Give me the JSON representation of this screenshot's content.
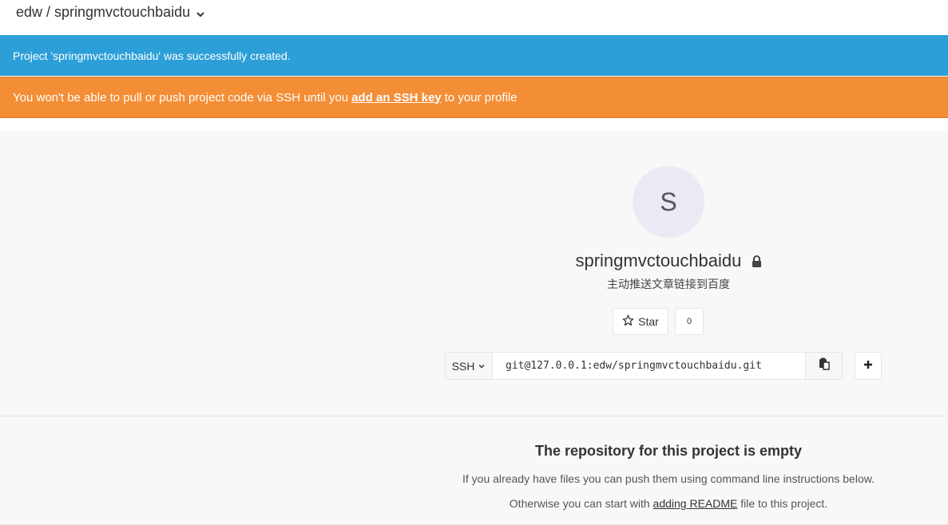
{
  "header": {
    "breadcrumb": "edw / springmvctouchbaidu"
  },
  "flash": {
    "notice": "Project 'springmvctouchbaidu' was successfully created.",
    "warning_prefix": "You won't be able to pull or push project code via SSH until you",
    "warning_link": "add an SSH key",
    "warning_suffix": "to your profile"
  },
  "project": {
    "avatar_letter": "S",
    "name": "springmvctouchbaidu",
    "description": "主动推送文章链接到百度",
    "star_label": "Star",
    "star_count": "0",
    "protocol": "SSH",
    "clone_url": "git@127.0.0.1:edw/springmvctouchbaidu.git"
  },
  "empty_repo": {
    "title": "The repository for this project is empty",
    "line1": "If you already have files you can push them using command line instructions below.",
    "line2_prefix": "Otherwise you can start with",
    "line2_link": "adding README",
    "line2_suffix": "file to this project."
  },
  "colors": {
    "notice_bg": "#2d9fd8",
    "warning_bg": "#f48e36",
    "avatar_bg": "#e9eaf4"
  },
  "icons": {
    "breadcrumb": "chevron-down-icon",
    "visibility": "lock-icon",
    "star": "star-outline-icon",
    "protocol": "chevron-down-icon",
    "copy": "clipboard-icon",
    "add": "plus-icon"
  }
}
